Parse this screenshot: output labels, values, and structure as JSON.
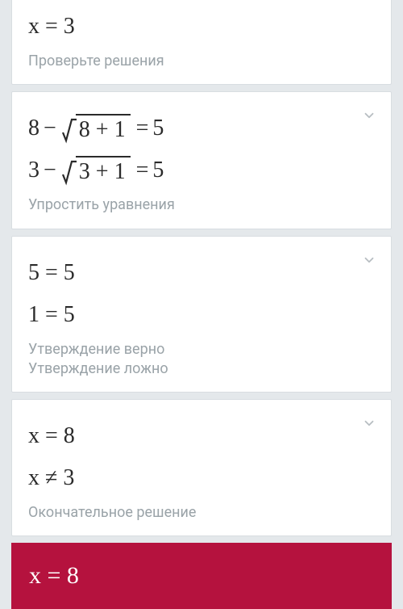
{
  "card0": {
    "line1": "x = 3",
    "caption": "Проверьте решения"
  },
  "card1": {
    "lhs1_a": "8",
    "rad1": "8 + 1",
    "rhs1": "5",
    "lhs2_a": "3",
    "rad2": "3 + 1",
    "rhs2": "5",
    "caption": "Упростить уравнения"
  },
  "card2": {
    "line1": "5 = 5",
    "line2": "1 = 5",
    "caption1": "Утверждение верно",
    "caption2": "Утверждение ложно"
  },
  "card3": {
    "line1": "x = 8",
    "line2": "x ≠ 3",
    "caption": "Окончательное решение"
  },
  "answer": {
    "text": "x = 8"
  },
  "ops": {
    "minus": "−",
    "eq": "="
  }
}
